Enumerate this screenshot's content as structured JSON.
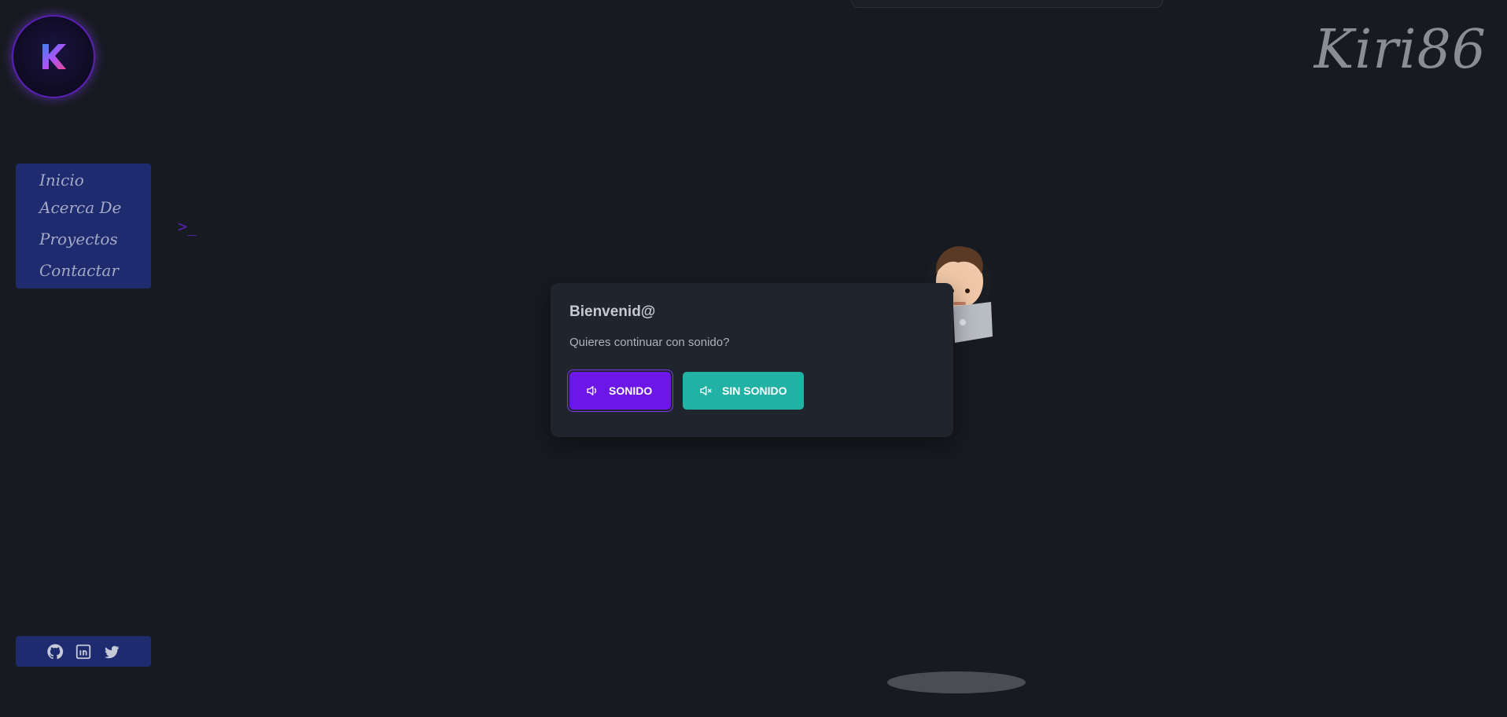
{
  "brand": {
    "logo_letter_icon": "k-logo-icon",
    "signature": "Kiri86",
    "accent": "#6d16e8",
    "teal": "#21b2a5"
  },
  "nav": {
    "items": [
      {
        "label": "Inicio"
      },
      {
        "label": "Acerca De"
      },
      {
        "label": "Proyectos"
      },
      {
        "label": "Contactar"
      }
    ],
    "prompt_glyph": ">_"
  },
  "social": {
    "icons": [
      "github-icon",
      "linkedin-icon",
      "twitter-icon"
    ]
  },
  "modal": {
    "title": "Bienvenid@",
    "message": "Quieres continuar con sonido?",
    "sound_label": "SONIDO",
    "mute_label": "SIN SONIDO",
    "sound_icon": "speaker-icon",
    "mute_icon": "speaker-muted-icon"
  }
}
